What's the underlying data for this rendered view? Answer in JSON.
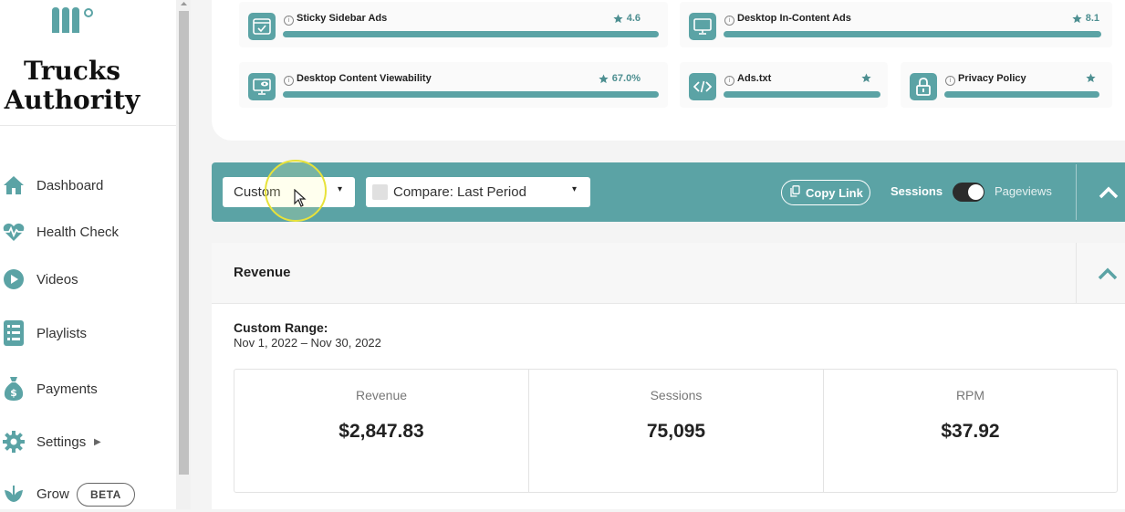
{
  "brand": {
    "name_line1": "Trucks",
    "name_line2": "Authority"
  },
  "sidebar": {
    "items": [
      {
        "label": "Dashboard",
        "icon": "home-icon"
      },
      {
        "label": "Health Check",
        "icon": "heartbeat-icon"
      },
      {
        "label": "Videos",
        "icon": "play-circle-icon"
      },
      {
        "label": "Playlists",
        "icon": "list-icon"
      },
      {
        "label": "Payments",
        "icon": "money-bag-icon"
      },
      {
        "label": "Settings",
        "icon": "gear-icon"
      },
      {
        "label": "Grow",
        "icon": "leaf-icon",
        "badge": "BETA"
      }
    ]
  },
  "checks": [
    {
      "name": "Sticky Sidebar Ads",
      "score": "4.6",
      "icon": "browser-check-icon"
    },
    {
      "name": "Desktop In-Content Ads",
      "score": "8.1",
      "icon": "monitor-icon"
    },
    {
      "name": "Desktop Content Viewability",
      "score": "67.0%",
      "icon": "monitor-eye-icon"
    },
    {
      "name": "Ads.txt",
      "score": "",
      "icon": "code-icon"
    },
    {
      "name": "Privacy Policy",
      "score": "",
      "icon": "lock-icon"
    }
  ],
  "toolbar": {
    "date_range": "Custom",
    "compare": "Compare: Last Period",
    "copy_link": "Copy Link",
    "toggle_left": "Sessions",
    "toggle_right": "Pageviews"
  },
  "revenue": {
    "title": "Revenue",
    "range_title": "Custom Range:",
    "range_dates": "Nov 1, 2022 – Nov 30, 2022",
    "stats": [
      {
        "label": "Revenue",
        "value": "$2,847.83"
      },
      {
        "label": "Sessions",
        "value": "75,095"
      },
      {
        "label": "RPM",
        "value": "$37.92"
      }
    ]
  },
  "colors": {
    "accent": "#5ba3a5",
    "accent_dark": "#4d8f91"
  }
}
